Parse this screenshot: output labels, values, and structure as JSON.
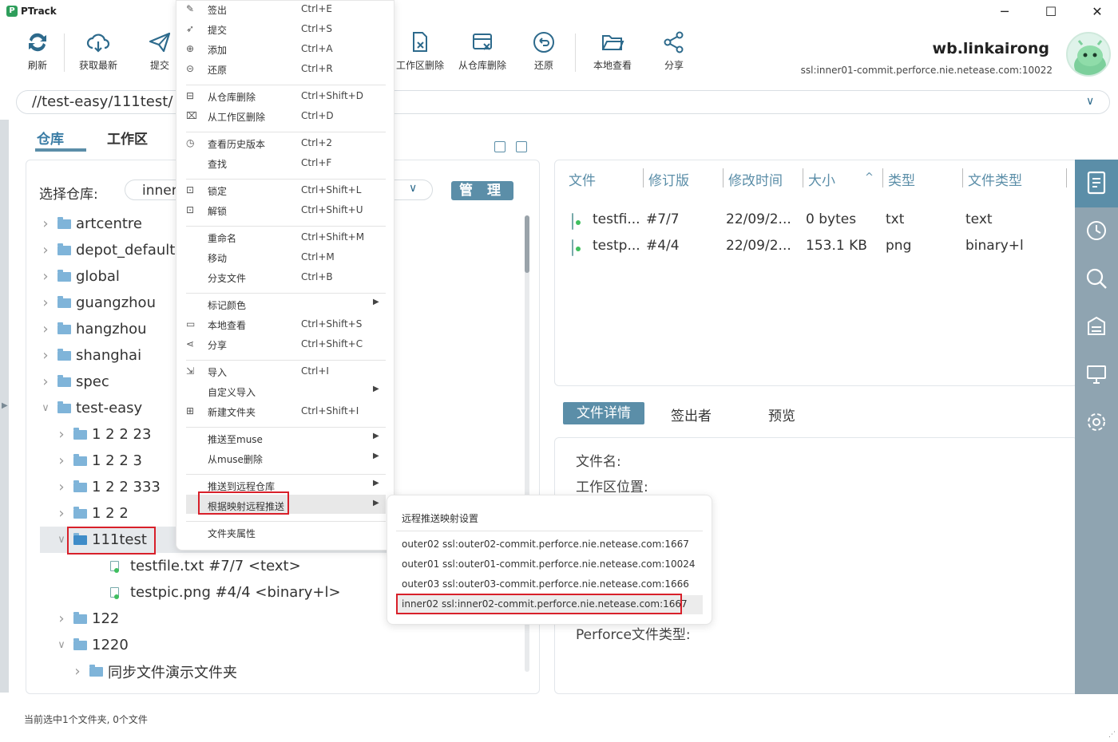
{
  "app": {
    "title": "PTrack"
  },
  "window": {
    "minimize": "─",
    "maximize": "☐",
    "close": "✕"
  },
  "toolbar": [
    {
      "label": "刷新",
      "icon": "refresh-icon"
    },
    {
      "label": "获取最新",
      "icon": "cloud-download-icon"
    },
    {
      "label": "提交",
      "icon": "send-icon"
    },
    {
      "label": "工作区删除",
      "icon": "file-delete-icon"
    },
    {
      "label": "从仓库删除",
      "icon": "repo-delete-icon"
    },
    {
      "label": "还原",
      "icon": "revert-icon"
    },
    {
      "label": "本地查看",
      "icon": "folder-open-icon"
    },
    {
      "label": "分享",
      "icon": "share-icon"
    }
  ],
  "user": {
    "name": "wb.linkairong",
    "server": "ssl:inner01-commit.perforce.nie.netease.com:10022"
  },
  "path": {
    "value": "//test-easy/111test/"
  },
  "tabs": {
    "repo": "仓库",
    "workspace": "工作区"
  },
  "repo_select": {
    "label": "选择仓库:",
    "value": "inner",
    "manage": "管 理"
  },
  "tree": [
    {
      "label": "artcentre",
      "level": 0,
      "expanded": false
    },
    {
      "label": "depot_default",
      "level": 0,
      "expanded": false
    },
    {
      "label": "global",
      "level": 0,
      "expanded": false
    },
    {
      "label": "guangzhou",
      "level": 0,
      "expanded": false
    },
    {
      "label": "hangzhou",
      "level": 0,
      "expanded": false
    },
    {
      "label": "shanghai",
      "level": 0,
      "expanded": false
    },
    {
      "label": "spec",
      "level": 0,
      "expanded": false
    },
    {
      "label": "test-easy",
      "level": 0,
      "expanded": true
    },
    {
      "label": "1 2 2 23",
      "level": 1,
      "expanded": false
    },
    {
      "label": "1 2 2 3",
      "level": 1,
      "expanded": false
    },
    {
      "label": "1 2 2 333",
      "level": 1,
      "expanded": false
    },
    {
      "label": "1 2 2",
      "level": 1,
      "expanded": false
    },
    {
      "label": "111test",
      "level": 1,
      "expanded": true,
      "selected": true
    },
    {
      "label": "testfile.txt  #7/7 <text>",
      "level": 2,
      "file": true
    },
    {
      "label": "testpic.png  #4/4 <binary+l>",
      "level": 2,
      "file": true
    },
    {
      "label": "122",
      "level": 1,
      "expanded": false
    },
    {
      "label": "1220",
      "level": 1,
      "expanded": true
    },
    {
      "label": "同步文件演示文件夹",
      "level": 2,
      "expanded": false
    }
  ],
  "file_table": {
    "headers": [
      "文件",
      "修订版",
      "修改时间",
      "大小",
      "类型",
      "文件类型"
    ],
    "sort_indicator": "^",
    "rows": [
      {
        "name": "testfi...",
        "rev": "#7/7",
        "time": "22/09/2...",
        "size": "0 bytes",
        "type": "txt",
        "ftype": "text"
      },
      {
        "name": "testp...",
        "rev": "#4/4",
        "time": "22/09/2...",
        "size": "153.1 KB",
        "type": "png",
        "ftype": "binary+l"
      }
    ]
  },
  "detail_tabs": {
    "detail": "文件详情",
    "checkout": "签出者",
    "preview": "预览"
  },
  "detail_labels": {
    "filename": "文件名:",
    "ws_location": "工作区位置:",
    "perforce_type": "Perforce文件类型:"
  },
  "status": "当前选中1个文件夹, 0个文件",
  "context_menu": [
    {
      "label": "签出",
      "shortcut": "Ctrl+E",
      "icon": "edit-icon"
    },
    {
      "label": "提交",
      "shortcut": "Ctrl+S",
      "icon": "send-icon"
    },
    {
      "label": "添加",
      "shortcut": "Ctrl+A",
      "icon": "plus-circle-icon"
    },
    {
      "label": "还原",
      "shortcut": "Ctrl+R",
      "icon": "revert-icon"
    },
    {
      "sep": true
    },
    {
      "label": "从仓库删除",
      "shortcut": "Ctrl+Shift+D",
      "icon": "repo-delete-icon"
    },
    {
      "label": "从工作区删除",
      "shortcut": "Ctrl+D",
      "icon": "file-delete-icon"
    },
    {
      "sep": true
    },
    {
      "label": "查看历史版本",
      "shortcut": "Ctrl+2",
      "icon": "clock-icon"
    },
    {
      "label": "查找",
      "shortcut": "Ctrl+F",
      "icon": ""
    },
    {
      "sep": true
    },
    {
      "label": "锁定",
      "shortcut": "Ctrl+Shift+L",
      "icon": "lock-icon"
    },
    {
      "label": "解锁",
      "shortcut": "Ctrl+Shift+U",
      "icon": "unlock-icon"
    },
    {
      "sep": true
    },
    {
      "label": "重命名",
      "shortcut": "Ctrl+Shift+M",
      "icon": ""
    },
    {
      "label": "移动",
      "shortcut": "Ctrl+M",
      "icon": ""
    },
    {
      "label": "分支文件",
      "shortcut": "Ctrl+B",
      "icon": ""
    },
    {
      "sep": true
    },
    {
      "label": "标记颜色",
      "shortcut": "",
      "icon": "",
      "submenu": true
    },
    {
      "label": "本地查看",
      "shortcut": "Ctrl+Shift+S",
      "icon": "folder-open-icon"
    },
    {
      "label": "分享",
      "shortcut": "Ctrl+Shift+C",
      "icon": "share-icon"
    },
    {
      "sep": true
    },
    {
      "label": "导入",
      "shortcut": "Ctrl+I",
      "icon": "import-icon"
    },
    {
      "label": "自定义导入",
      "shortcut": "",
      "icon": "",
      "submenu": true
    },
    {
      "label": "新建文件夹",
      "shortcut": "Ctrl+Shift+I",
      "icon": "new-folder-icon"
    },
    {
      "sep": true
    },
    {
      "label": "推送至muse",
      "shortcut": "",
      "icon": "",
      "submenu": true
    },
    {
      "label": "从muse删除",
      "shortcut": "",
      "icon": "",
      "submenu": true
    },
    {
      "sep": true
    },
    {
      "label": "推送到远程仓库",
      "shortcut": "",
      "icon": "",
      "submenu": true
    },
    {
      "label": "根据映射远程推送",
      "shortcut": "",
      "icon": "",
      "submenu": true,
      "highlighted": true
    },
    {
      "sep": true
    },
    {
      "label": "文件夹属性",
      "shortcut": "",
      "icon": ""
    }
  ],
  "submenu": {
    "header": "远程推送映射设置",
    "items": [
      "outer02 ssl:outer02-commit.perforce.nie.netease.com:1667",
      "outer01 ssl:outer01-commit.perforce.nie.netease.com:10024",
      "outer03 ssl:outer03-commit.perforce.nie.netease.com:1666",
      "inner02 ssl:inner02-commit.perforce.nie.netease.com:1667"
    ]
  },
  "colors": {
    "accent": "#5b8ea8",
    "highlight_border": "#d8202a",
    "rail": "#8fa4b1"
  }
}
